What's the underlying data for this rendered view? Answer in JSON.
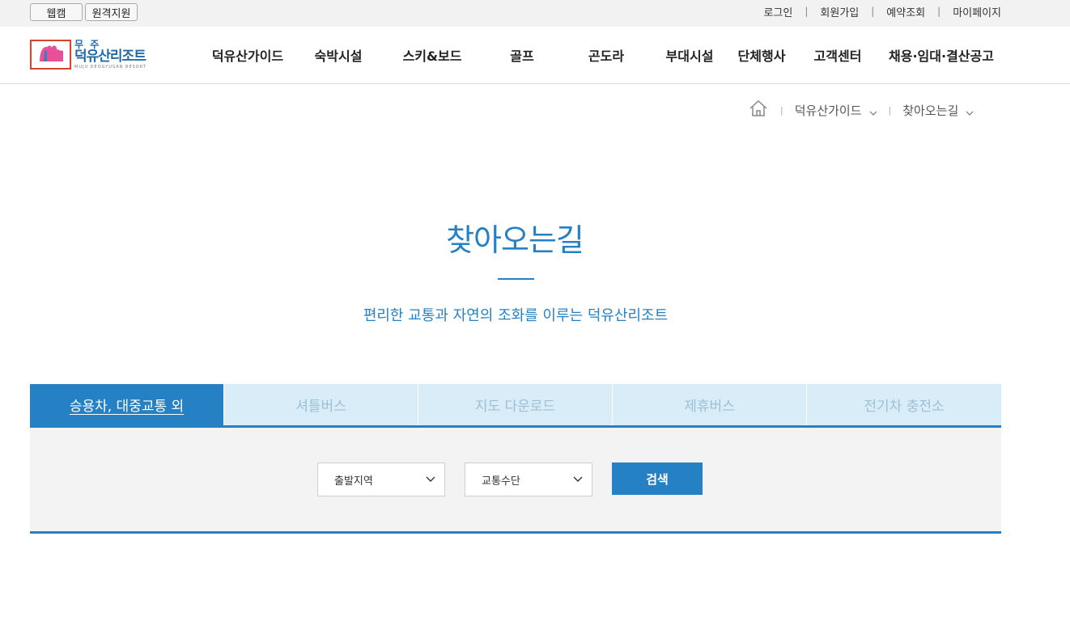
{
  "topbar": {
    "webcam_label": "웹캠",
    "remote_label": "원격지원",
    "links": [
      "로그인",
      "회원가입",
      "예약조회",
      "마이페이지"
    ]
  },
  "logo": {
    "small": "무 주",
    "big": "덕유산리조트",
    "tiny": "MUJU DEOGYUSAN RESORT"
  },
  "gnb": [
    "덕유산가이드",
    "숙박시설",
    "스키&보드",
    "골프",
    "곤도라",
    "부대시설",
    "단체행사",
    "고객센터",
    "채용·임대·결산공고"
  ],
  "breadcrumb": {
    "home_icon": "home-icon",
    "level1": "덕유산가이드",
    "level2": "찾아오는길"
  },
  "page": {
    "title": "찾아오는길",
    "subtitle": "편리한 교통과 자연의 조화를 이루는 덕유산리조트"
  },
  "tabs": [
    "승용차, 대중교통 외",
    "셔틀버스",
    "지도 다운로드",
    "제휴버스",
    "전기차 충전소"
  ],
  "search": {
    "region_value": "출발지역",
    "transport_value": "교통수단",
    "button_label": "검색"
  },
  "colors": {
    "accent": "#2581c4",
    "tab_inactive_bg": "#d9edf8",
    "tab_inactive_text": "#9cbfd6",
    "logo_border": "#d6442b"
  }
}
